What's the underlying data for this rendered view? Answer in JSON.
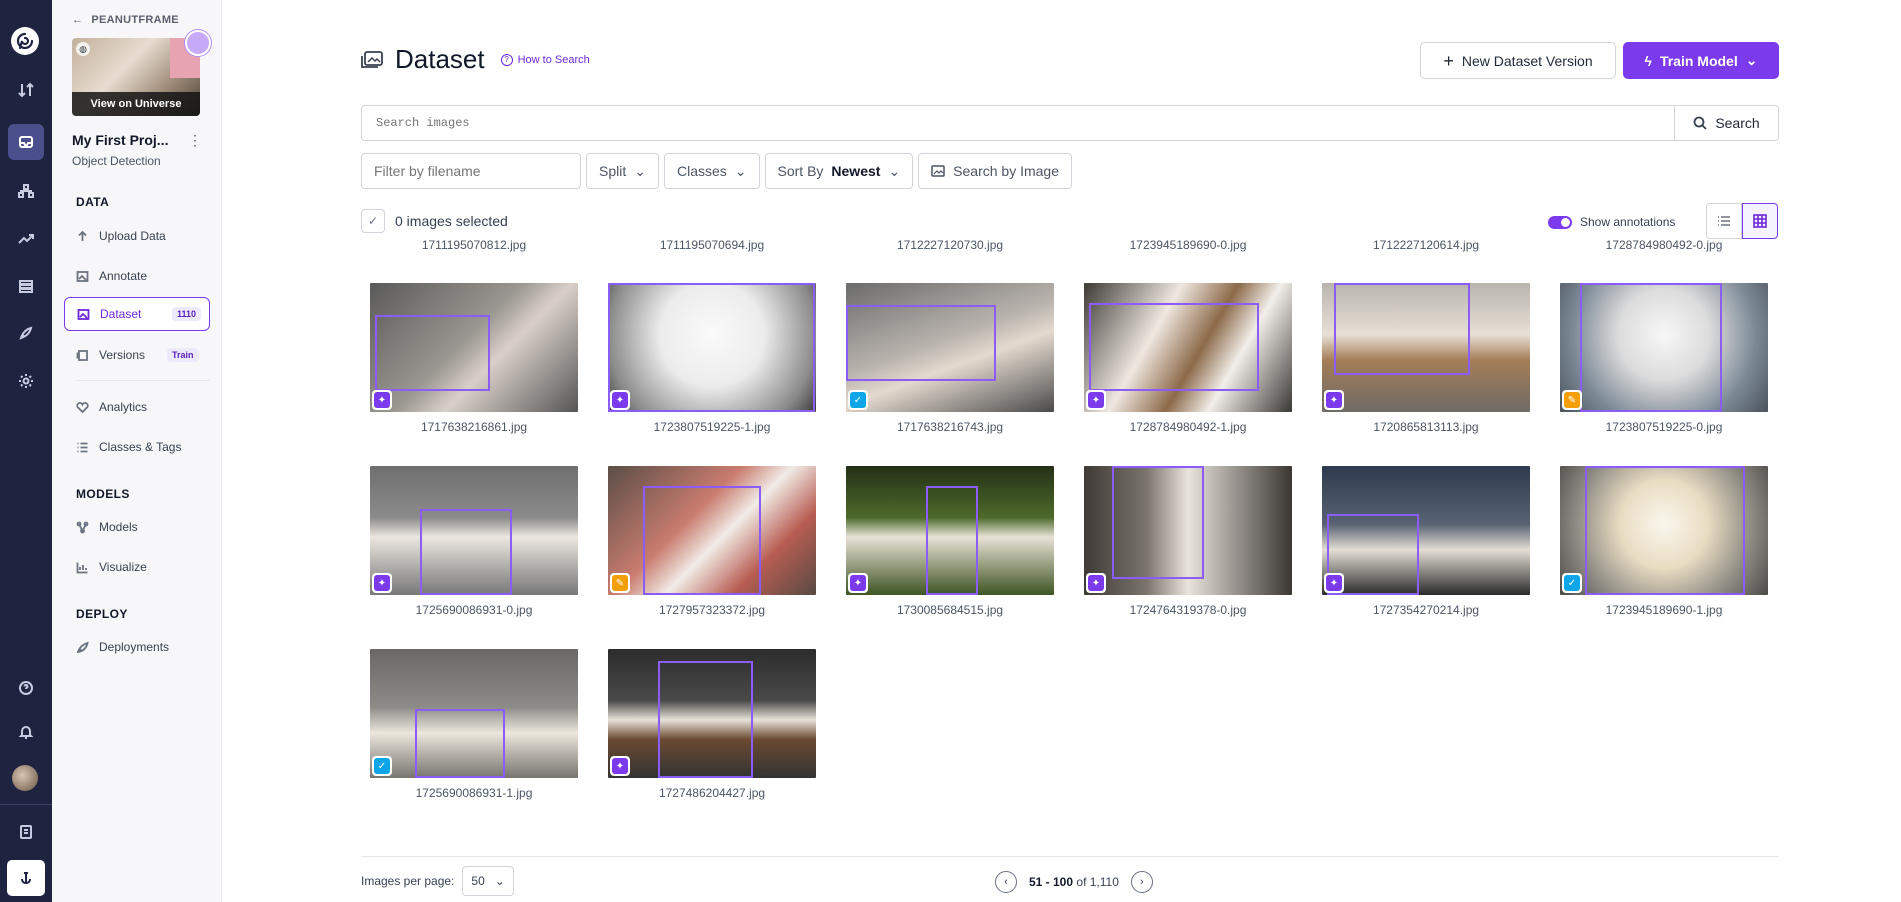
{
  "project": {
    "workspace": "PEANUTFRAME",
    "universe_label": "View on Universe",
    "name": "My First Proj...",
    "type": "Object Detection"
  },
  "sidebar": {
    "sections": {
      "data": "DATA",
      "models": "MODELS",
      "deploy": "DEPLOY"
    },
    "items": {
      "upload": "Upload Data",
      "annotate": "Annotate",
      "dataset": "Dataset",
      "dataset_count": "1110",
      "versions": "Versions",
      "versions_badge": "Train",
      "analytics": "Analytics",
      "classes": "Classes & Tags",
      "models": "Models",
      "visualize": "Visualize",
      "deployments": "Deployments"
    }
  },
  "header": {
    "title": "Dataset",
    "how_to": "How to Search",
    "new_version": "New Dataset Version",
    "train": "Train Model"
  },
  "search": {
    "placeholder": "Search images",
    "button": "Search"
  },
  "filters": {
    "filename_placeholder": "Filter by filename",
    "split": "Split",
    "classes": "Classes",
    "sort_label": "Sort By",
    "sort_value": "Newest",
    "by_image": "Search by Image"
  },
  "selection": {
    "text": "0 images selected"
  },
  "show_annotations": "Show annotations",
  "previous_row": [
    "1711195070812.jpg",
    "1711195070694.jpg",
    "1712227120730.jpg",
    "1723945189690-0.jpg",
    "1712227120614.jpg",
    "1728784980492-0.jpg"
  ],
  "images": [
    {
      "name": "1717638216861.jpg",
      "tag": "annotated",
      "bg": "linear-gradient(135deg,#5a5a5a,#9a9690 45%,#d9cfc8 60%,#555)"
    },
    {
      "name": "1723807519225-1.jpg",
      "tag": "annotated",
      "bg": "radial-gradient(circle at 50% 40%,#fafafa 0%,#ececec 40%,#8a8a8a 80%,#3a3a3a)"
    },
    {
      "name": "1717638216743.jpg",
      "tag": "approved",
      "bg": "linear-gradient(160deg,#6b6b6b,#b9b3ad 45%,#e4d9cf 60%,#4a4a4a)"
    },
    {
      "name": "1728784980492-1.jpg",
      "tag": "annotated",
      "bg": "linear-gradient(120deg,#3d3a36,#efe7e0 35%,#8c6a4a 55%,#f2eee9 70%,#3a3835)"
    },
    {
      "name": "1720865813113.jpg",
      "tag": "annotated",
      "bg": "linear-gradient(180deg,#b9b5ae,#e7dfd6 40%,#a57d57 60%,#6f6b66)"
    },
    {
      "name": "1723807519225-0.jpg",
      "tag": "pending",
      "bg": "radial-gradient(circle at 50% 40%,#f7f7f7 0%,#dcdcdc 35%,#7d8a96 70%,#4a525a)"
    },
    {
      "name": "1725690086931-0.jpg",
      "tag": "annotated",
      "bg": "linear-gradient(180deg,#6f6f6f,#8b8b8b 40%,#ebe6df 55%,#787878)"
    },
    {
      "name": "1727957323372.jpg",
      "tag": "pending",
      "bg": "linear-gradient(135deg,#5b4e46,#c97c6f 40%,#f1ece7 55%,#b85d52 75%,#574a42)"
    },
    {
      "name": "1730085684515.jpg",
      "tag": "annotated",
      "bg": "linear-gradient(180deg,#243016,#4d6a2b 40%,#e8e2d6 55%,#3f5523)"
    },
    {
      "name": "1724764319378-0.jpg",
      "tag": "annotated",
      "bg": "linear-gradient(90deg,#3f3a35,#7a746d 30%,#e9e3dc 50%,#3a3632)"
    },
    {
      "name": "1727354270214.jpg",
      "tag": "annotated",
      "bg": "linear-gradient(180deg,#2e3a4e,#586272 45%,#e3ddd4 65%,#2a2b2a)"
    },
    {
      "name": "1723945189690-1.jpg",
      "tag": "approved",
      "bg": "radial-gradient(circle at 50% 45%,#fbf7ee 0%,#e8dcc2 35%,#8d8a83 70%,#4b4a47)"
    },
    {
      "name": "1725690086931-1.jpg",
      "tag": "approved",
      "bg": "linear-gradient(180deg,#6a6866,#8d8b88 45%,#ece6dd 65%,#77746f)"
    },
    {
      "name": "1727486204427.jpg",
      "tag": "annotated",
      "bg": "linear-gradient(180deg,#2c2c2c,#4a4a4a 40%,#e7e1d8 55%,#6b4a31 70%,#333)"
    }
  ],
  "footer": {
    "per_page_label": "Images per page:",
    "per_page_value": "50",
    "range": "51 - 100",
    "of_label": "of",
    "total": "1,110"
  },
  "colors": {
    "accent": "#7c3aed",
    "rail": "#1e2340",
    "approved": "#0ea5e9",
    "pending": "#f59e0b"
  }
}
